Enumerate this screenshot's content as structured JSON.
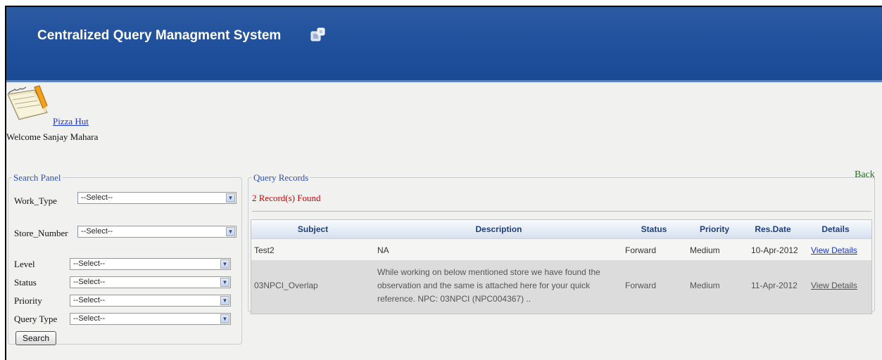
{
  "header": {
    "title": "Centralized Query Managment System"
  },
  "org": {
    "name": "Pizza Hut",
    "welcome": "Welcome Sanjay Mahara"
  },
  "nav": {
    "back": "Back"
  },
  "search_panel": {
    "legend": "Search Panel",
    "fields": [
      {
        "label": "Work_Type",
        "value": "--Select--"
      },
      {
        "label": "Store_Number",
        "value": "--Select--"
      },
      {
        "label": "Level",
        "value": "--Select--"
      },
      {
        "label": "Status",
        "value": "--Select--"
      },
      {
        "label": "Priority",
        "value": "--Select--"
      },
      {
        "label": "Query Type",
        "value": "--Select--"
      }
    ],
    "search_button": "Search"
  },
  "records": {
    "legend": "Query Records",
    "count": "2 Record(s) Found",
    "columns": [
      "Subject",
      "Description",
      "Status",
      "Priority",
      "Res.Date",
      "Details"
    ],
    "rows": [
      {
        "subject": "Test2",
        "description": "NA",
        "status": "Forward",
        "priority": "Medium",
        "res_date": "10-Apr-2012",
        "details": "View Details"
      },
      {
        "subject": "03NPCI_Overlap",
        "description_lines": [
          "While working on below mentioned store we have found the",
          "observation and the same is attached here for your quick",
          "reference. NPC: 03NPCI (NPC004367) .."
        ],
        "status": "Forward",
        "priority": "Medium",
        "res_date": "11-Apr-2012",
        "details": "View Details"
      }
    ]
  }
}
